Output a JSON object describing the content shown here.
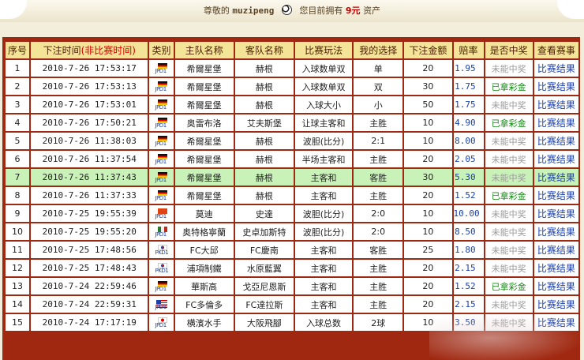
{
  "topbar": {
    "greeting": "尊敬的",
    "username": "muzipeng",
    "balance_prefix": "您目前拥有",
    "balance": "9元",
    "balance_suffix": "资产"
  },
  "table": {
    "headers": {
      "seq": "序号",
      "time": "下注时间",
      "time_note": "(非比赛时间)",
      "type": "类别",
      "home": "主队名称",
      "away": "客队名称",
      "play": "比赛玩法",
      "choice": "我的选择",
      "amount": "下注金额",
      "odds": "赔率",
      "prize": "是否中奖",
      "view": "查看赛事"
    },
    "rows": [
      {
        "seq": "1",
        "time": "2010-7-26  17:53:17",
        "type": "de",
        "home": "希爾星堡",
        "away": "赫根",
        "play": "入球数单双",
        "choice": "单",
        "amount": "20",
        "odds": "1.95",
        "prize": "未能中奖",
        "view": "比赛结果"
      },
      {
        "seq": "2",
        "time": "2010-7-26  17:53:13",
        "type": "de",
        "home": "希爾星堡",
        "away": "赫根",
        "play": "入球数单双",
        "choice": "双",
        "amount": "30",
        "odds": "1.75",
        "prize": "已拿彩金",
        "view": "比赛结果"
      },
      {
        "seq": "3",
        "time": "2010-7-26  17:53:01",
        "type": "de",
        "home": "希爾星堡",
        "away": "赫根",
        "play": "入球大小",
        "choice": "小",
        "amount": "50",
        "odds": "1.75",
        "prize": "未能中奖",
        "view": "比赛结果"
      },
      {
        "seq": "4",
        "time": "2010-7-26  17:50:21",
        "type": "de",
        "home": "奥雷布洛",
        "away": "艾夫斯堡",
        "play": "让球主客和",
        "choice": "主胜",
        "amount": "10",
        "odds": "4.90",
        "prize": "已拿彩金",
        "view": "比赛结果"
      },
      {
        "seq": "5",
        "time": "2010-7-26  11:38:03",
        "type": "de",
        "home": "希爾星堡",
        "away": "赫根",
        "play": "波胆(比分)",
        "choice": "2:1",
        "amount": "10",
        "odds": "8.00",
        "prize": "未能中奖",
        "view": "比赛结果"
      },
      {
        "seq": "6",
        "time": "2010-7-26  11:37:54",
        "type": "de",
        "home": "希爾星堡",
        "away": "赫根",
        "play": "半场主客和",
        "choice": "主胜",
        "amount": "20",
        "odds": "2.05",
        "prize": "未能中奖",
        "view": "比赛结果"
      },
      {
        "seq": "7",
        "time": "2010-7-26  11:37:43",
        "type": "de",
        "home": "希爾星堡",
        "away": "赫根",
        "play": "主客和",
        "choice": "客胜",
        "amount": "30",
        "odds": "5.30",
        "prize": "未能中奖",
        "view": "比赛结果"
      },
      {
        "seq": "8",
        "time": "2010-7-26  11:37:33",
        "type": "de",
        "home": "希爾星堡",
        "away": "赫根",
        "play": "主客和",
        "choice": "主胜",
        "amount": "20",
        "odds": "1.52",
        "prize": "已拿彩金",
        "view": "比赛结果"
      },
      {
        "seq": "9",
        "time": "2010-7-25  19:55:39",
        "type": "cn",
        "home": "莫迪",
        "away": "史達",
        "play": "波胆(比分)",
        "choice": "2:0",
        "amount": "10",
        "odds": "10.00",
        "prize": "未能中奖",
        "view": "比赛结果"
      },
      {
        "seq": "10",
        "time": "2010-7-25  19:55:20",
        "type": "gen",
        "home": "奥特格寧蘭",
        "away": "史卓加斯特",
        "play": "波胆(比分)",
        "choice": "2:0",
        "amount": "10",
        "odds": "8.50",
        "prize": "未能中奖",
        "view": "比赛结果"
      },
      {
        "seq": "11",
        "time": "2010-7-25  17:48:56",
        "type": "kr",
        "home": "FC大邱",
        "away": "FC慶南",
        "play": "主客和",
        "choice": "客胜",
        "amount": "25",
        "odds": "1.80",
        "prize": "未能中奖",
        "view": "比赛结果"
      },
      {
        "seq": "12",
        "time": "2010-7-25  17:48:43",
        "type": "kr",
        "home": "浦項制鐵",
        "away": "水原藍翼",
        "play": "主客和",
        "choice": "主胜",
        "amount": "20",
        "odds": "2.15",
        "prize": "未能中奖",
        "view": "比赛结果"
      },
      {
        "seq": "13",
        "time": "2010-7-24  22:59:46",
        "type": "de",
        "home": "華斯高",
        "away": "戈亞尼恩斯",
        "play": "主客和",
        "choice": "主胜",
        "amount": "20",
        "odds": "1.52",
        "prize": "已拿彩金",
        "view": "比赛结果"
      },
      {
        "seq": "14",
        "time": "2010-7-24  22:59:31",
        "type": "us",
        "home": "FC多倫多",
        "away": "FC達拉斯",
        "play": "主客和",
        "choice": "主胜",
        "amount": "20",
        "odds": "2.15",
        "prize": "未能中奖",
        "view": "比赛结果"
      },
      {
        "seq": "15",
        "time": "2010-7-24  17:17:19",
        "type": "jp",
        "home": "横濱水手",
        "away": "大阪飛腳",
        "play": "入球总数",
        "choice": "2球",
        "amount": "10",
        "odds": "3.50",
        "prize": "未能中奖",
        "view": "比赛结果"
      }
    ],
    "highlight_row": 6,
    "type_tag": "JPD1",
    "type_tag_kr": "PKD1"
  },
  "colors": {
    "frame": "#a02810",
    "header_bg": "#f3e497",
    "highlight": "#c9f2b8",
    "won": "#128a12",
    "lost": "#9a9a9a",
    "link": "#1a3fa8"
  }
}
